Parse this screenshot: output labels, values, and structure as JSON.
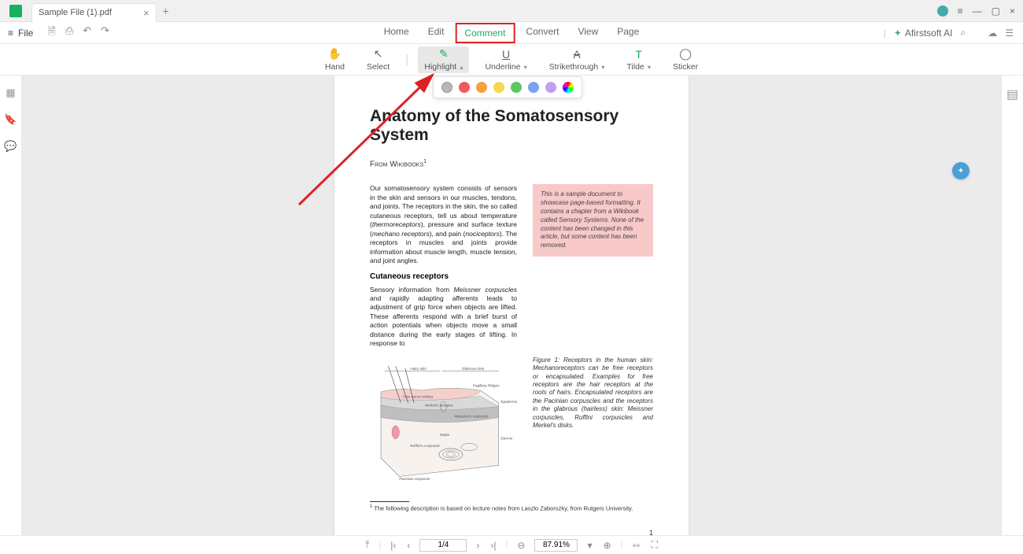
{
  "titlebar": {
    "tab_name": "Sample File (1).pdf"
  },
  "filemenu": {
    "label": "File"
  },
  "mainmenu": {
    "home": "Home",
    "edit": "Edit",
    "comment": "Comment",
    "convert": "Convert",
    "view": "View",
    "page": "Page"
  },
  "ai": {
    "label": "Afirstsoft AI"
  },
  "toolbar": {
    "hand": "Hand",
    "select": "Select",
    "highlight": "Highlight",
    "underline": "Underline",
    "strike": "Strikethrough",
    "tilde": "Tilde",
    "sticker": "Sticker"
  },
  "palette": {
    "colors": [
      "#b8b8b8",
      "#f05a5a",
      "#f2a33c",
      "#f2d94e",
      "#5cc763",
      "#7aa4f0",
      "#c59ef0",
      "rainbow"
    ]
  },
  "doc": {
    "title": "Anatomy of the Somatosensory System",
    "source": "From Wikibooks",
    "para1_a": "Our somatosensory system consists of sensors in the skin and sensors in our muscles, tendons, and joints. The receptors in the skin, the so called cutaneous receptors, tell us about temperature (",
    "para1_b": "thermoreceptors",
    "para1_c": "), pressure and surface texture (",
    "para1_d": "mechano receptors",
    "para1_e": "), and pain (",
    "para1_f": "nociceptors",
    "para1_g": "). The receptors in muscles and joints provide information about muscle length, muscle tension, and joint angles.",
    "note": "This is a sample document to showcase page-based formatting. It contains a chapter from a Wikibook called Sensory Systems. None of the content has been changed in this article, but some content has been removed.",
    "subhead": "Cutaneous receptors",
    "para2_a": "Sensory information from ",
    "para2_b": "Meissner corpuscles",
    "para2_c": " and rapidly adapting afferents leads to adjustment of grip force when objects are lifted. These afferents respond with a brief burst of action potentials when objects move a small distance during the early stages of lifting. In response to",
    "fig_lead": "Figure 1:",
    "fig_caption": " Receptors in the human skin: Mechanoreceptors can be free receptors or encapsulated. Examples for free receptors are the hair receptors at the roots of hairs. Encapsulated receptors are the Pacinian corpuscles and the receptors in the glabrous (hairless) skin: Meissner corpuscles, Ruffini corpuscles and Merkel's disks.",
    "footnote": " The following description is based on lecture notes from Laszlo Zaborszky, from Rutgers University.",
    "labels": {
      "hairy": "Hairy skin",
      "glabrous": "Glabrous skin",
      "papillary": "Papillary Ridges",
      "epidermis": "Epidermis",
      "dermis": "Dermis",
      "freenerve": "Free nerve ending",
      "merkel": "Merkel's receptor",
      "meissner": "Meissner's corpuscle",
      "ruffini": "Ruffini's corpuscle",
      "pacinian": "Pacinian corpuscle",
      "septa": "Septa"
    },
    "page_number": "1"
  },
  "status": {
    "page": "1/4",
    "zoom": "87.91%"
  }
}
